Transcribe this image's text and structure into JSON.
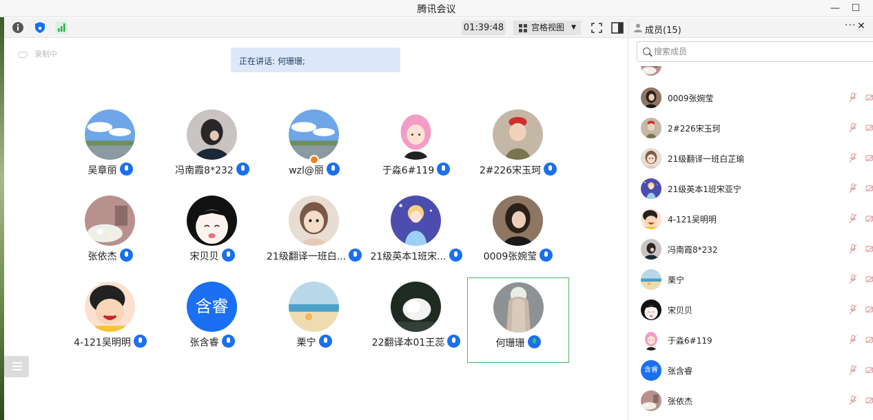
{
  "window": {
    "title": "腾讯会议",
    "minimize_glyph": "—",
    "maximize_glyph": "☐"
  },
  "toolbar": {
    "info_icon": "info-icon",
    "shield_icon": "shield-icon",
    "signal_icon": "signal-icon",
    "timer": "01:39:48",
    "view_label": "宫格视图",
    "view_caret": "▼",
    "fullscreen_icon": "fullscreen-icon",
    "sidebar_icon": "sidebar-toggle-icon"
  },
  "stage": {
    "recording_label": "录制中",
    "speaking_label": "正在讲话: 何珊珊;"
  },
  "tiles": [
    {
      "name": "吴章丽",
      "avatar": "sky-photo"
    },
    {
      "name": "冯南霞8*232",
      "avatar": "girl-photo"
    },
    {
      "name": "wzl@丽",
      "avatar": "sky-photo",
      "host": true
    },
    {
      "name": "于淼6#119",
      "avatar": "pink-hair-cartoon"
    },
    {
      "name": "2#226宋玉珂",
      "avatar": "baby-photo"
    },
    {
      "name": "张依杰",
      "avatar": "flower-photo"
    },
    {
      "name": "宋贝贝",
      "avatar": "anime-face"
    },
    {
      "name": "21级翻译一班白...",
      "avatar": "child-photo"
    },
    {
      "name": "21级英本1班宋...",
      "avatar": "princess-cartoon"
    },
    {
      "name": "0009张婉莹",
      "avatar": "woman-photo"
    },
    {
      "name": "4-121吴明明",
      "avatar": "cartoon-girl"
    },
    {
      "name": "张含睿",
      "avatar": "text-avatar",
      "avatar_text": "含睿"
    },
    {
      "name": "栗宁",
      "avatar": "beach-photo"
    },
    {
      "name": "22翻译本01王蕊",
      "avatar": "cat-photo"
    },
    {
      "name": "何珊珊",
      "avatar": "back-photo",
      "speaking": true
    }
  ],
  "panel": {
    "title": "成员(15)",
    "more": "···",
    "close": "✕",
    "search_placeholder": "搜索成员",
    "members": [
      {
        "name": "0009张婉莹",
        "avatar": "woman-photo"
      },
      {
        "name": "2#226宋玉珂",
        "avatar": "baby-photo"
      },
      {
        "name": "21级翻译一班白芷瑜",
        "avatar": "child-photo"
      },
      {
        "name": "21级英本1班宋亚宁",
        "avatar": "princess-cartoon"
      },
      {
        "name": "4-121吴明明",
        "avatar": "cartoon-girl"
      },
      {
        "name": "冯南霞8*232",
        "avatar": "girl-photo"
      },
      {
        "name": "栗宁",
        "avatar": "beach-photo"
      },
      {
        "name": "宋贝贝",
        "avatar": "anime-face"
      },
      {
        "name": "于淼6#119",
        "avatar": "pink-hair-cartoon"
      },
      {
        "name": "张含睿",
        "avatar": "text-avatar",
        "avatar_text": "含睿"
      },
      {
        "name": "张依杰",
        "avatar": "flower-photo"
      }
    ]
  },
  "colors": {
    "accent": "#1a6ff2",
    "speaking_border": "#43b86a",
    "speaking_banner": "#dde9f8",
    "host_badge": "#f2811d",
    "muted_icon": "#e0a0a0"
  }
}
